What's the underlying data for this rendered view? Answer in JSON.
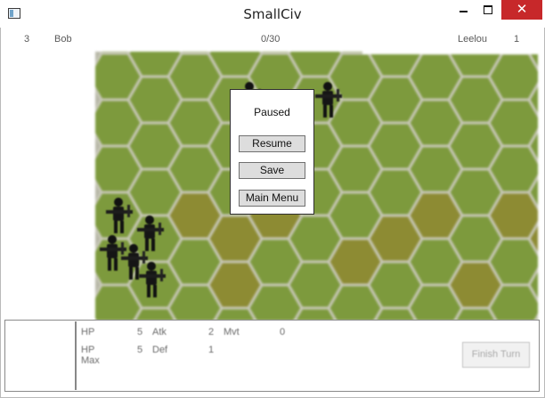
{
  "window": {
    "title": "SmallCiv"
  },
  "top_bar": {
    "player1_score": "3",
    "player1_name": "Bob",
    "turn_counter": "0/30",
    "player2_name": "Leelou",
    "player2_score": "1"
  },
  "pause_menu": {
    "title": "Paused",
    "resume_label": "Resume",
    "save_label": "Save",
    "main_menu_label": "Main Menu"
  },
  "unit_panel": {
    "hp_label": "HP",
    "hp_value": "5",
    "atk_label": "Atk",
    "atk_value": "2",
    "mvt_label": "Mvt",
    "mvt_value": "0",
    "hp_max_label": "HP Max",
    "hp_max_value": "5",
    "def_label": "Def",
    "def_value": "1",
    "finish_turn_label": "Finish Turn"
  },
  "colors": {
    "grass": "#7d9a3d",
    "forest": "#8d8b33",
    "hex_border": "#c8c8b8",
    "close_button": "#c7282a"
  }
}
